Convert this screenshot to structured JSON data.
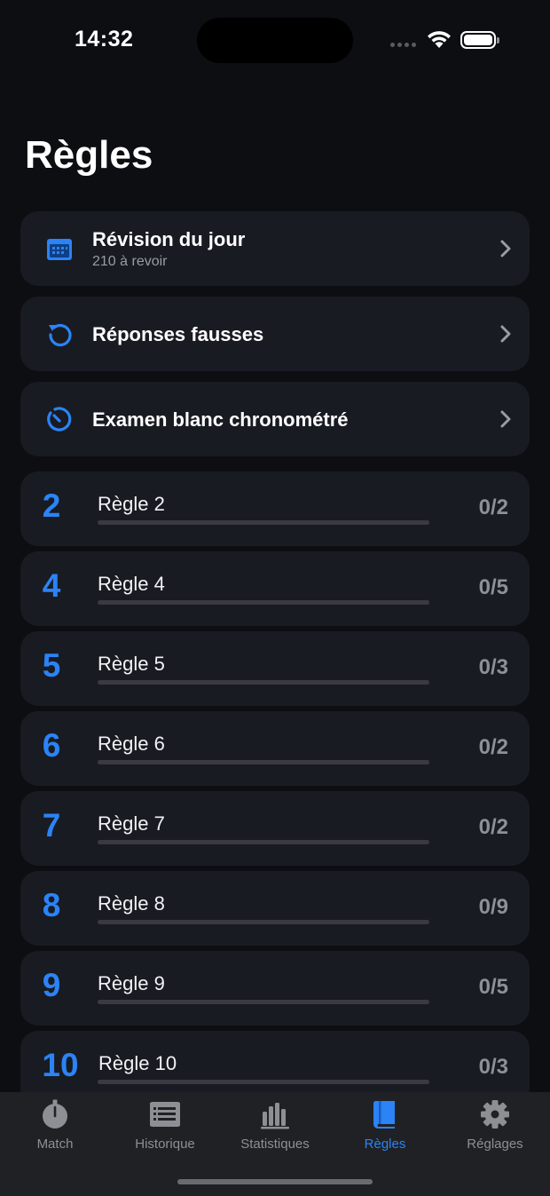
{
  "status": {
    "time": "14:32"
  },
  "page_title": "Règles",
  "actions": [
    {
      "title": "Révision du jour",
      "subtitle": "210 à revoir",
      "icon": "calendar-icon"
    },
    {
      "title": "Réponses fausses",
      "icon": "retry-arrow-icon"
    },
    {
      "title": "Examen blanc chronométré",
      "icon": "timer-icon"
    }
  ],
  "rules": [
    {
      "number": "2",
      "name": "Règle 2",
      "score": "0/2",
      "progress": 0
    },
    {
      "number": "4",
      "name": "Règle 4",
      "score": "0/5",
      "progress": 0
    },
    {
      "number": "5",
      "name": "Règle 5",
      "score": "0/3",
      "progress": 0
    },
    {
      "number": "6",
      "name": "Règle 6",
      "score": "0/2",
      "progress": 0
    },
    {
      "number": "7",
      "name": "Règle 7",
      "score": "0/2",
      "progress": 0
    },
    {
      "number": "8",
      "name": "Règle 8",
      "score": "0/9",
      "progress": 0
    },
    {
      "number": "9",
      "name": "Règle 9",
      "score": "0/5",
      "progress": 0
    },
    {
      "number": "10",
      "name": "Règle 10",
      "score": "0/3",
      "progress": 0
    }
  ],
  "tabs": [
    {
      "label": "Match",
      "icon": "stopwatch-icon",
      "active": false
    },
    {
      "label": "Historique",
      "icon": "list-icon",
      "active": false
    },
    {
      "label": "Statistiques",
      "icon": "bar-chart-icon",
      "active": false
    },
    {
      "label": "Règles",
      "icon": "book-icon",
      "active": true
    },
    {
      "label": "Réglages",
      "icon": "gear-icon",
      "active": false
    }
  ],
  "colors": {
    "accent": "#2b83f6",
    "background": "#0d0e12",
    "card": "#181b22",
    "tabbar": "#202125"
  }
}
